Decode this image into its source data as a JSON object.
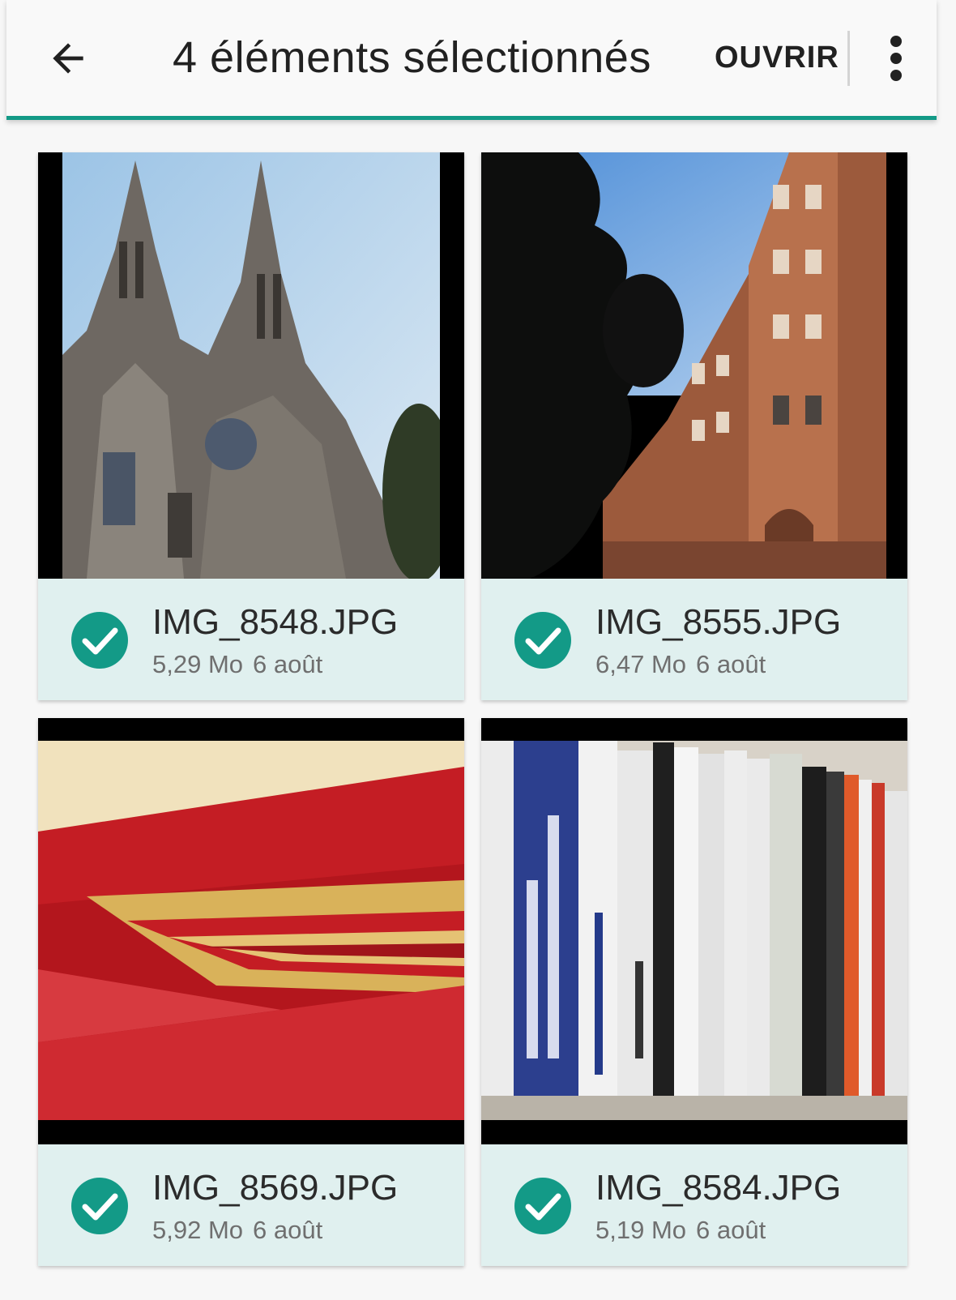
{
  "toolbar": {
    "back_icon": "arrow-left-icon",
    "title": "4 éléments sélectionnés",
    "open_label": "OUVRIR",
    "more_icon": "more-vertical-icon"
  },
  "colors": {
    "accent": "#139a87",
    "card_background": "#e0f0ef",
    "check": "#139a87"
  },
  "files": [
    {
      "name": "IMG_8548.JPG",
      "size": "5,29 Mo",
      "date": "6 août",
      "selected": true,
      "thumbnail": "cathedral-photo"
    },
    {
      "name": "IMG_8555.JPG",
      "size": "6,47 Mo",
      "date": "6 août",
      "selected": true,
      "thumbnail": "brick-building-photo"
    },
    {
      "name": "IMG_8569.JPG",
      "size": "5,92 Mo",
      "date": "6 août",
      "selected": true,
      "thumbnail": "red-staircase-photo"
    },
    {
      "name": "IMG_8584.JPG",
      "size": "5,19 Mo",
      "date": "6 août",
      "selected": true,
      "thumbnail": "bookshelf-photo"
    }
  ]
}
